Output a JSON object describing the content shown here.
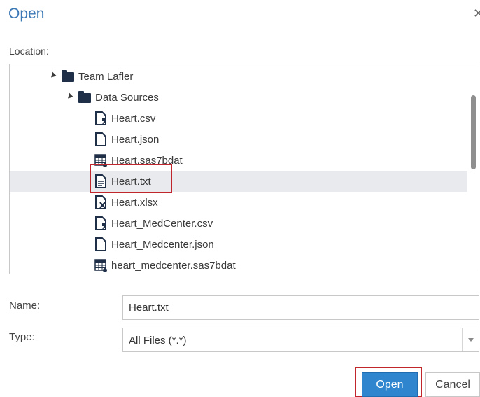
{
  "dialog": {
    "title": "Open",
    "close_icon": "close-icon"
  },
  "location": {
    "label": "Location:",
    "tree": [
      {
        "label": "Team Lafler",
        "icon": "folder-icon",
        "expanded": true
      },
      {
        "label": "Data Sources",
        "icon": "folder-icon",
        "expanded": true
      },
      {
        "label": "Heart.csv",
        "icon": "csv-file-icon"
      },
      {
        "label": "Heart.json",
        "icon": "json-file-icon"
      },
      {
        "label": "Heart.sas7bdat",
        "icon": "sas-dataset-icon"
      },
      {
        "label": "Heart.txt",
        "icon": "text-file-icon",
        "selected": true
      },
      {
        "label": "Heart.xlsx",
        "icon": "excel-file-icon"
      },
      {
        "label": "Heart_MedCenter.csv",
        "icon": "csv-file-icon"
      },
      {
        "label": "Heart_Medcenter.json",
        "icon": "json-file-icon"
      },
      {
        "label": "heart_medcenter.sas7bdat",
        "icon": "sas-dataset-icon"
      }
    ]
  },
  "name": {
    "label": "Name:",
    "value": "Heart.txt"
  },
  "type": {
    "label": "Type:",
    "value": "All Files (*.*)"
  },
  "buttons": {
    "open": "Open",
    "cancel": "Cancel"
  },
  "colors": {
    "title": "#3b78b5",
    "primary_button": "#2f86cf",
    "highlight_outline": "#c0262c",
    "selected_row": "#e8eaed"
  }
}
